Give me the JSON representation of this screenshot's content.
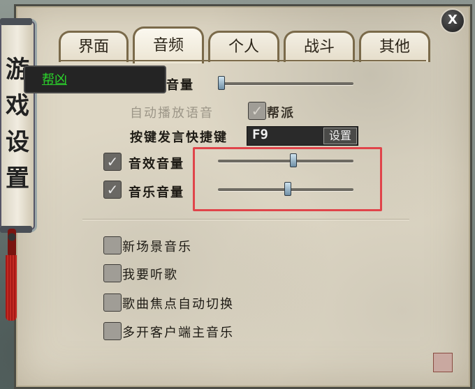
{
  "window": {
    "title_chars": [
      "游",
      "戏",
      "设",
      "置"
    ],
    "close_label": "X"
  },
  "tabs": [
    {
      "label": "界面",
      "active": false
    },
    {
      "label": "音频",
      "active": true
    },
    {
      "label": "个人",
      "active": false
    },
    {
      "label": "战斗",
      "active": false
    },
    {
      "label": "其他",
      "active": false
    }
  ],
  "voice": {
    "channel_name": "帮凶",
    "volume_label": "音量",
    "auto_play_label": "自动播放语音",
    "guild_label": "帮派",
    "hotkey_label": "按键发言快捷键",
    "hotkey_value": "F9",
    "hotkey_button": "设置"
  },
  "audio": {
    "sfx_label": "音效音量",
    "music_label": "音乐音量",
    "sfx_volume": 0.55,
    "music_volume": 0.51,
    "voice_volume": 0.02
  },
  "options": [
    {
      "label": "新场景音乐",
      "checked": false
    },
    {
      "label": "我要听歌",
      "checked": false
    },
    {
      "label": "歌曲焦点自动切换",
      "checked": false
    },
    {
      "label": "多开客户端主音乐",
      "checked": false
    }
  ],
  "colors": {
    "highlight_box": "#e0444a",
    "channel_text": "#2bd42b"
  }
}
